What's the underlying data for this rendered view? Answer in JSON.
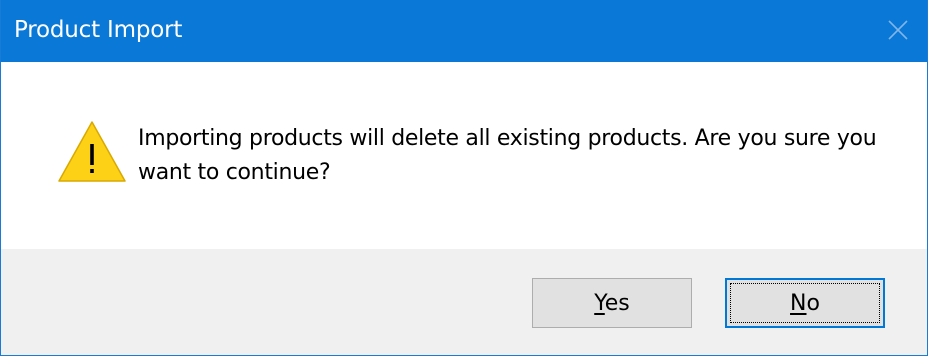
{
  "window": {
    "title": "Product Import",
    "close_icon": "close-icon",
    "titlebar_color": "#0a78d7"
  },
  "dialog": {
    "icon": "warning-icon",
    "message": "Importing products will delete all existing products. Are you sure you want to continue?"
  },
  "buttons": {
    "yes": {
      "mnemonic": "Y",
      "rest": "es",
      "label": "Yes"
    },
    "no": {
      "mnemonic": "N",
      "rest": "o",
      "label": "No"
    }
  }
}
